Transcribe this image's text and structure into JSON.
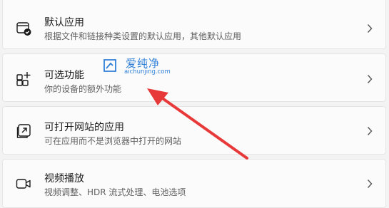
{
  "settings_list": {
    "items": [
      {
        "title": "默认应用",
        "description": "根据文件和链接种类设置的默认应用，其他默认应用",
        "icon": "default-apps-icon"
      },
      {
        "title": "可选功能",
        "description": "你的设备的额外功能",
        "icon": "optional-features-icon"
      },
      {
        "title": "可打开网站的应用",
        "description": "可在应用而不是浏览器中打开的网站",
        "icon": "apps-for-websites-icon"
      },
      {
        "title": "视频播放",
        "description": "视频调整、HDR 流式处理、电池选项",
        "icon": "video-playback-icon"
      }
    ]
  },
  "watermark": {
    "brand": "爱纯净",
    "url": "aichunjing.com"
  },
  "colors": {
    "arrow": "#e8393a",
    "watermark": "#2f7fd8",
    "card_bg": "#fbfbfb",
    "page_bg": "#f3f3f3"
  }
}
